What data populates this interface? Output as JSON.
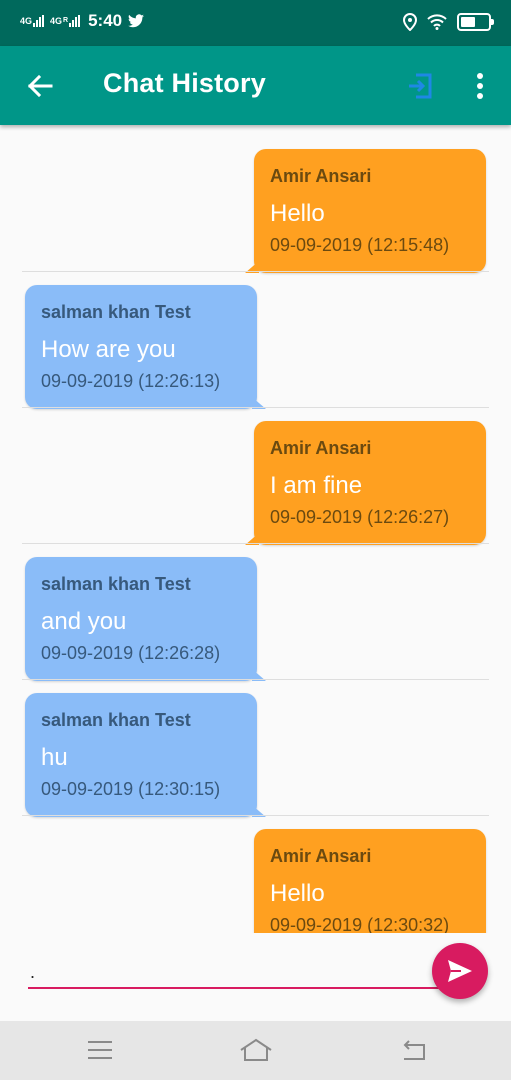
{
  "status_bar": {
    "network_1": "4G",
    "network_2": "4G",
    "network_2_sub": "R",
    "time": "5:40",
    "battery_level": 0.55,
    "icons": [
      "twitter-icon",
      "location-icon",
      "wifi-icon",
      "battery-icon"
    ]
  },
  "app_bar": {
    "title": "Chat History",
    "back_icon": "arrow-left-icon",
    "logout_icon": "exit-icon",
    "menu_icon": "more-vert-icon"
  },
  "messages": [
    {
      "direction": "sent",
      "sender": "Amir Ansari",
      "text": "Hello",
      "timestamp": "09-09-2019 (12:15:48)"
    },
    {
      "direction": "received",
      "sender": "salman khan Test",
      "text": "How are you",
      "timestamp": "09-09-2019 (12:26:13)"
    },
    {
      "direction": "sent",
      "sender": "Amir Ansari",
      "text": "I am fine",
      "timestamp": "09-09-2019 (12:26:27)"
    },
    {
      "direction": "received",
      "sender": "salman khan Test",
      "text": "and you",
      "timestamp": "09-09-2019 (12:26:28)"
    },
    {
      "direction": "received",
      "sender": "salman khan Test",
      "text": "hu",
      "timestamp": "09-09-2019 (12:30:15)"
    },
    {
      "direction": "sent",
      "sender": "Amir Ansari",
      "text": "Hello",
      "timestamp": "09-09-2019 (12:30:32)"
    }
  ],
  "composer": {
    "value": ".",
    "send_icon": "send-icon"
  },
  "nav_bar": {
    "icons": [
      "menu-icon",
      "home-icon",
      "back-icon"
    ]
  },
  "colors": {
    "status_bar": "#00695c",
    "app_bar": "#009688",
    "sent_bubble": "#ffa020",
    "received_bubble": "#8abcf8",
    "accent": "#d81b60",
    "logout_icon": "#1e88e5"
  }
}
